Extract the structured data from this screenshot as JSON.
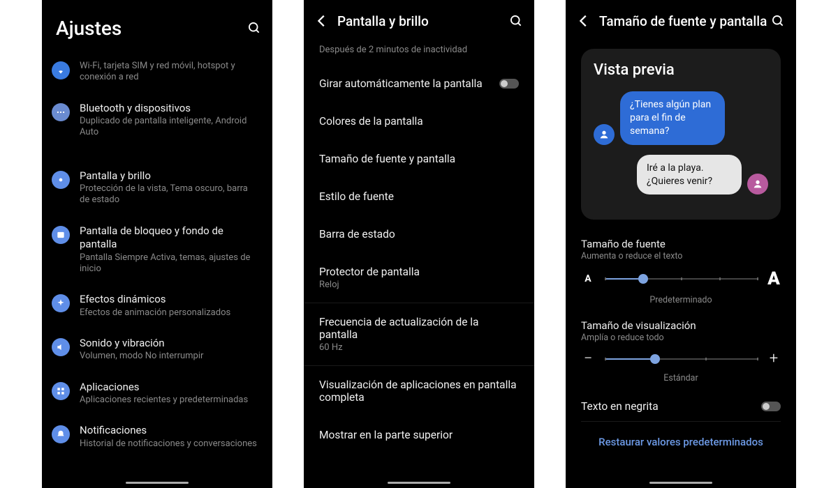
{
  "screen1": {
    "title": "Ajustes",
    "rows": [
      {
        "title": "",
        "sub": "Wi-Fi, tarjeta SIM y red móvil, hotspot y conexión a red",
        "icon_bg": "#3a7be0"
      },
      {
        "title": "Bluetooth y dispositivos",
        "sub": "Duplicado de pantalla inteligente, Android Auto",
        "icon_bg": "#6a8bd0"
      },
      {
        "title": "Pantalla y brillo",
        "sub": "Protección de la vista, Tema oscuro, barra de estado",
        "icon_bg": "#5f8ee8"
      },
      {
        "title": "Pantalla de bloqueo y fondo de pantalla",
        "sub": "Pantalla Siempre Activa, temas, ajustes de inicio",
        "icon_bg": "#5f8ee8"
      },
      {
        "title": "Efectos dinámicos",
        "sub": "Efectos de animación personalizados",
        "icon_bg": "#5f8ee8"
      },
      {
        "title": "Sonido y vibración",
        "sub": "Volumen, modo No interrumpir",
        "icon_bg": "#5f8ee8"
      },
      {
        "title": "Aplicaciones",
        "sub": "Aplicaciones recientes y predeterminadas",
        "icon_bg": "#5f8ee8"
      },
      {
        "title": "Notificaciones",
        "sub": "Historial de notificaciones y conversaciones",
        "icon_bg": "#5f8ee8"
      }
    ]
  },
  "screen2": {
    "title": "Pantalla y brillo",
    "desc": "Después de 2 minutos de inactividad",
    "rows": [
      {
        "title": "Girar automáticamente la pantalla",
        "toggle": true
      },
      {
        "title": "Colores de la pantalla"
      },
      {
        "title": "Tamaño de fuente y pantalla"
      },
      {
        "title": "Estilo de fuente"
      },
      {
        "title": "Barra de estado"
      },
      {
        "title": "Protector de pantalla",
        "sub": "Reloj"
      },
      {
        "title": "Frecuencia de actualización de la pantalla",
        "sub": "60 Hz"
      },
      {
        "title": "Visualización de aplicaciones en pantalla completa"
      },
      {
        "title": "Mostrar en la parte superior"
      }
    ]
  },
  "screen3": {
    "title": "Tamaño de fuente y pantalla",
    "preview_title": "Vista previa",
    "msg1": "¿Tienes algún plan para el fin de semana?",
    "msg2": "Iré a la playa. ¿Quieres venir?",
    "font_size_title": "Tamaño de fuente",
    "font_size_sub": "Aumenta o reduce el texto",
    "font_size_label": "Predeterminado",
    "display_size_title": "Tamaño de visualización",
    "display_size_sub": "Amplía o reduce todo",
    "display_size_label": "Estándar",
    "bold_text": "Texto en negrita",
    "reset": "Restaurar valores predeterminados"
  }
}
